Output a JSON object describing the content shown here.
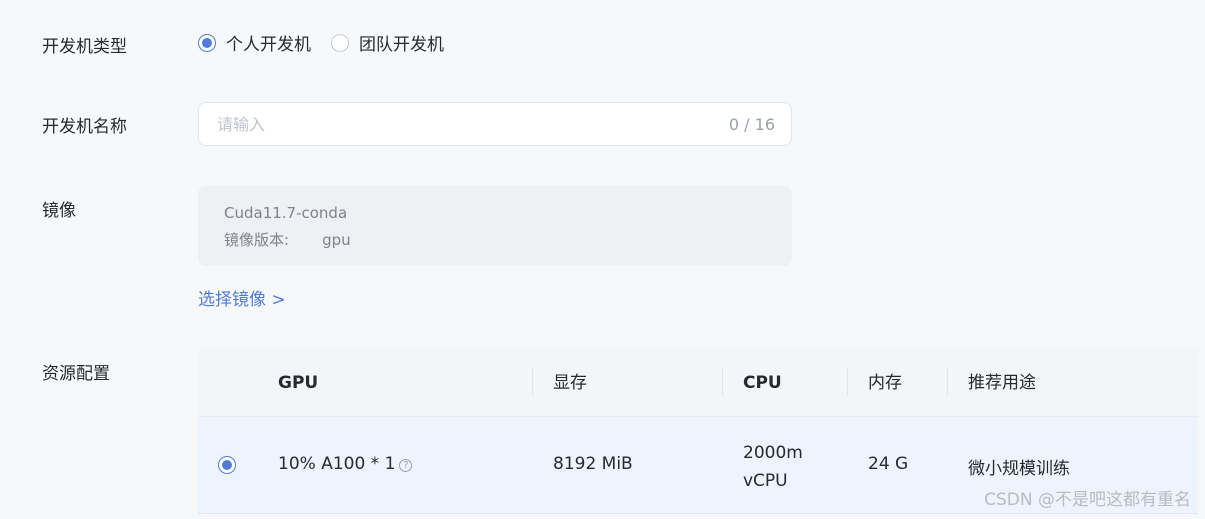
{
  "form": {
    "type_label": "开发机类型",
    "type_options": [
      {
        "label": "个人开发机",
        "selected": true
      },
      {
        "label": "团队开发机",
        "selected": false
      }
    ],
    "name_label": "开发机名称",
    "name_placeholder": "请输入",
    "name_value": "",
    "name_counter": "0 / 16",
    "image_label": "镜像",
    "image_name": "Cuda11.7-conda",
    "image_version_label": "镜像版本:",
    "image_version_value": "gpu",
    "select_image_link": "选择镜像 >",
    "resource_label": "资源配置"
  },
  "table": {
    "headers": {
      "gpu": "GPU",
      "memory": "显存",
      "cpu": "CPU",
      "ram": "内存",
      "usage": "推荐用途"
    },
    "rows": [
      {
        "selected": true,
        "gpu": "10% A100 * 1",
        "memory": "8192 MiB",
        "cpu_line1": "2000m",
        "cpu_line2": "vCPU",
        "ram": "24 G",
        "usage": "微小规模训练"
      }
    ]
  },
  "icons": {
    "help": "help-circle-icon"
  },
  "colors": {
    "accent": "#4f7cdc",
    "selected_row_bg": "#eef4fe"
  },
  "watermark": "CSDN @不是吧这都有重名"
}
